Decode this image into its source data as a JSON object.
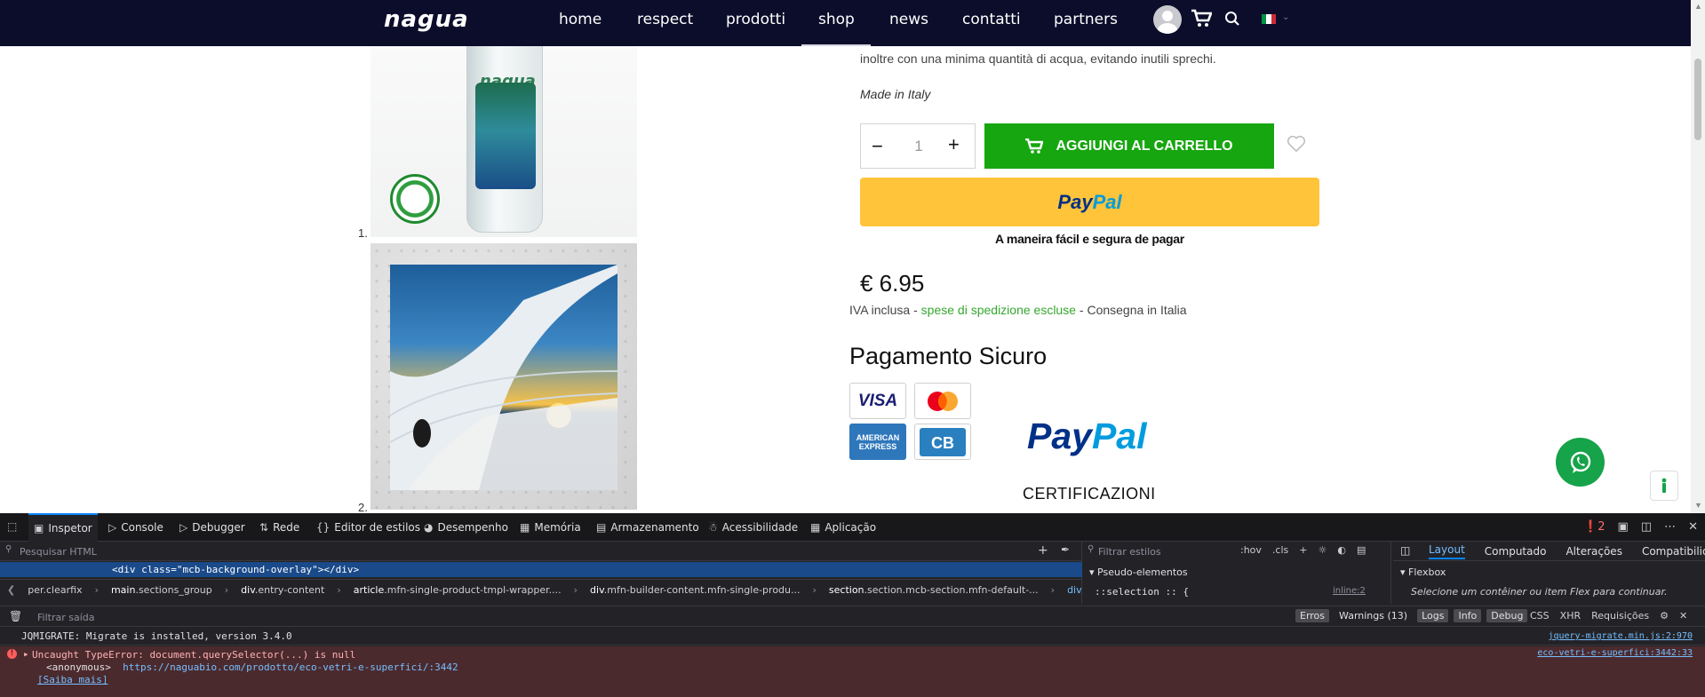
{
  "nav": {
    "logo": "nagua",
    "items": [
      "home",
      "respect",
      "prodotti",
      "shop",
      "news",
      "contatti",
      "partners"
    ]
  },
  "gallery": {
    "num1": "1.",
    "num2": "2.",
    "bottle_brand": "nagua"
  },
  "product": {
    "description": "inoltre con una minima quantità di acqua, evitando inutili sprechi.",
    "made_in": "Made in Italy",
    "quantity_value": "1",
    "add_to_cart": "AGGIUNGI AL CARRELLO",
    "paypal_button_pay": "Pay",
    "paypal_button_pal": "Pal",
    "paypal_tagline": "A maneira fácil e segura de pagar",
    "price": "€ 6.95",
    "vat_prefix": "IVA inclusa - ",
    "vat_link": "spese di spedizione escluse",
    "vat_suffix": " - Consegna in Italia",
    "secure_title": "Pagamento Sicuro",
    "visa": "VISA",
    "amex": "AMERICAN EXPRESS",
    "paypal_logo_pay": "Pay",
    "paypal_logo_pal": "Pal",
    "certifications": "CERTIFICAZIONI"
  },
  "colors": {
    "nav_bg": "#0c0d2b",
    "add_cart": "#16a60f",
    "paypal_yellow": "#ffc439",
    "link_green": "#35a82e",
    "whatsapp": "#16a34a"
  },
  "devtools": {
    "tabs": [
      "Inspetor",
      "Console",
      "Debugger",
      "Rede",
      "Editor de estilos",
      "Desempenho",
      "Memória",
      "Armazenamento",
      "Acessibilidade",
      "Aplicação"
    ],
    "error_count": "2",
    "html_search_placeholder": "Pesquisar HTML",
    "selected_node": "<div class=\"mcb-background-overlay\"></div>",
    "breadcrumbs": [
      {
        "tag": "",
        "cls": "per.clearfix"
      },
      {
        "tag": "main",
        "cls": ".sections_group"
      },
      {
        "tag": "div",
        "cls": ".entry-content"
      },
      {
        "tag": "article",
        "cls": ".mfn-single-product-tmpl-wrapper...."
      },
      {
        "tag": "div",
        "cls": ".mfn-builder-content.mfn-single-produ..."
      },
      {
        "tag": "section",
        "cls": ".section.mcb-section.mfn-default-..."
      },
      {
        "tag": "div",
        "cls": ".mcb-background-overlay"
      }
    ],
    "styles_filter_placeholder": "Filtrar estilos",
    "rules_tools": [
      ":hov",
      ".cls"
    ],
    "pseudo_header": "Pseudo-elementos",
    "selection_rule": "::selection :: {",
    "inline_ref": "inline:2",
    "layout_tabs": [
      "Layout",
      "Computado",
      "Alterações",
      "Compatibilida"
    ],
    "flexbox_header": "Flexbox",
    "flexbox_msg": "Selecione um contêiner ou item Flex para continuar.",
    "console_filter_placeholder": "Filtrar saída",
    "levels": [
      "Erros",
      "Warnings (13)",
      "Logs",
      "Info",
      "Debug"
    ],
    "types": [
      "CSS",
      "XHR",
      "Requisições"
    ],
    "msg1": "JQMIGRATE: Migrate is installed, version 3.4.0",
    "msg1_src": "jquery-migrate.min.js:2:970",
    "msg2_line1": "Uncaught TypeError: document.querySelector(...) is null",
    "msg2_anon": "<anonymous>",
    "msg2_url": "https://naguabio.com/prodotto/eco-vetri-e-superfici/:3442",
    "msg2_learn": "[Saiba mais]",
    "msg2_src": "eco-vetri-e-superfici:3442:33"
  }
}
